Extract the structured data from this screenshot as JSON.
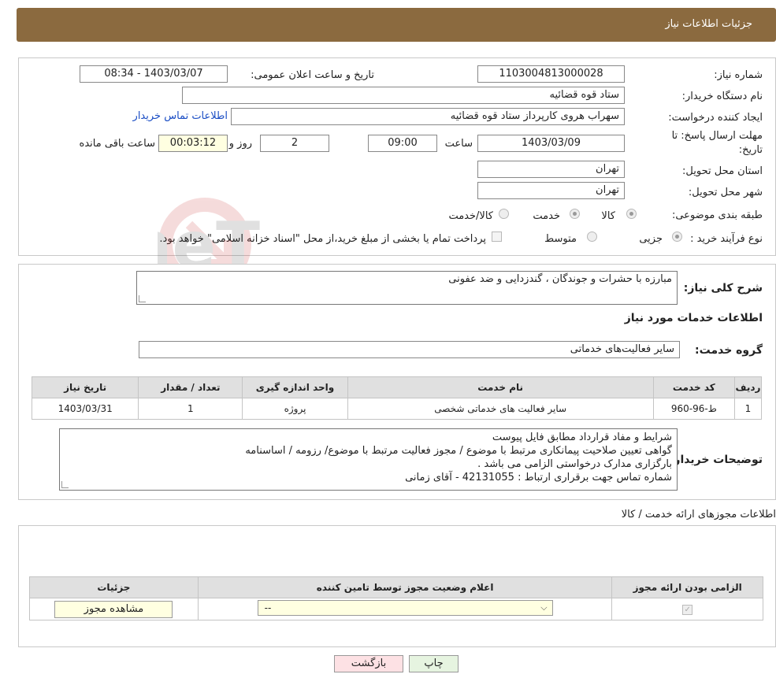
{
  "header": {
    "title": "جزئیات اطلاعات نیاز"
  },
  "form": {
    "need_number_label": "شماره نیاز:",
    "need_number": "1103004813000028",
    "announce_label": "تاریخ و ساعت اعلان عمومی:",
    "announce_value": "1403/03/07 - 08:34",
    "buyer_org_label": "نام دستگاه خریدار:",
    "buyer_org": "ستاد قوه قضائیه",
    "creator_label": "ایجاد کننده درخواست:",
    "creator": "سهراب هروی کارپرداز ستاد قوه قضائیه",
    "contact_link": "اطلاعات تماس خریدار",
    "deadline_label_1": "مهلت ارسال پاسخ: تا",
    "deadline_label_2": "تاریخ:",
    "deadline_date": "1403/03/09",
    "time_label": "ساعت",
    "deadline_time": "09:00",
    "days_value": "2",
    "days_label": "روز و",
    "remaining_value": "00:03:12",
    "remaining_label": "ساعت باقی مانده",
    "province_label": "استان محل تحویل:",
    "province": "تهران",
    "city_label": "شهر محل تحویل:",
    "city": "تهران",
    "category_label": "طبقه بندی موضوعی:",
    "category_options": [
      "کالا",
      "خدمت",
      "کالا/خدمت"
    ],
    "process_label": "نوع فرآیند خرید :",
    "process_options": [
      "جزیی",
      "متوسط"
    ],
    "process_note": "پرداخت تمام یا بخشی از مبلغ خرید،از محل \"اسناد خزانه اسلامی\" خواهد بود."
  },
  "description": {
    "label": "شرح کلی نیاز:",
    "text": "مبارزه با حشرات و جوندگان ، گندزدایی و ضد عفونی"
  },
  "services": {
    "section_title": "اطلاعات خدمات مورد نیاز",
    "group_label": "گروه خدمت:",
    "group_value": "سایر فعالیت‌های خدماتی",
    "columns": [
      "ردیف",
      "کد خدمت",
      "نام خدمت",
      "واحد اندازه گیری",
      "تعداد / مقدار",
      "تاریخ نیاز"
    ],
    "rows": [
      [
        "1",
        "ط-96-960",
        "سایر فعالیت های خدماتی شخصی",
        "پروژه",
        "1",
        "1403/03/31"
      ]
    ]
  },
  "buyer_notes": {
    "label": "توضیحات خریدار:",
    "lines": [
      "شرایط و مفاد قرارداد مطابق فایل پیوست",
      "گواهی تعیین صلاحیت پیمانکاری مرتبط با موضوع / مجوز فعالیت مرتبط با موضوع/ رزومه / اساسنامه",
      "بارگزاری مدارک درخواستی الزامی می باشد .",
      "شماره تماس جهت برقراری ارتباط : 42131055 - آقای زمانی"
    ]
  },
  "permits": {
    "section_title": "اطلاعات مجوزهای ارائه خدمت / کالا",
    "columns": [
      "الزامی بودن ارائه مجوز",
      "اعلام وضعیت مجوز توسط تامین کننده",
      "جزئیات"
    ],
    "select_value": "--",
    "view_button": "مشاهده مجوز"
  },
  "buttons": {
    "print": "چاپ",
    "back": "بازگشت"
  },
  "watermark": "AriaTender.neT"
}
